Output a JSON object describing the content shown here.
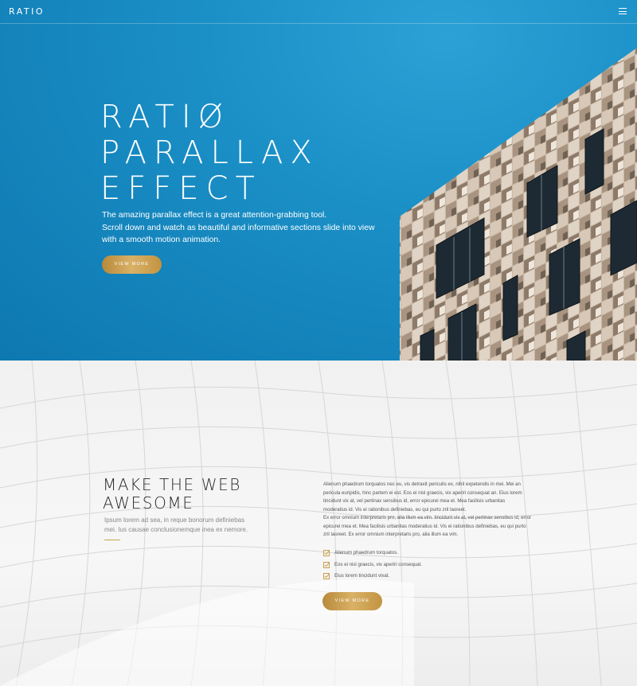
{
  "header": {
    "logo": "RATIO",
    "menu_icon": "hamburger-icon"
  },
  "hero": {
    "title_lines": [
      "RATIØ",
      "PARALLAX",
      "EFFECT"
    ],
    "description_lines": [
      "The amazing parallax effect is a great attention-grabbing tool.",
      "Scroll down and watch as beautiful and informative sections slide into view",
      "with a smooth motion animation."
    ],
    "button_label": "VIEW MORE",
    "bg_color": "#1a8fc6"
  },
  "section2": {
    "title_lines": [
      "MAKE THE WEB",
      "AWESOME"
    ],
    "subtitle_lines": [
      "Ipsum lorem ad sea, in reque bonorum definiebas",
      "mei. Ius causae conclusionemque inea ex nemore."
    ],
    "body_lines": [
      "Alienum phaedrum torquatos nec eu, vis detraxit periculis ex, nihil expetendis in mei. Mei an",
      "pericula euripidis, hinc partem ei est. Eos ei nisl graecis, vix aperiri consequat an. Eius lorem",
      "tincidunt vix at, vel pertinax sensibus id, error epicurei mea et. Mea facilisis urbanitas",
      "moderatius id. Vis ei rationibus definiebas, eu qui purto zril laoreet.",
      "Ex error omnium interpretaris pro, alia illum ea vim. tincidunt vix at, vel pertinax sensibus id, error",
      "epicurei mea et. Mea facilisis urbanitas moderatius id. Vis ei rationibus definiebas, eu qui purto",
      "zril laoreet. Ex error omnium interpretaris pro, alia illum ea vim."
    ],
    "checklist": [
      "Alienum phaedrum torquatos.",
      "Eos ei nisl graecis, vix aperiri consequat.",
      "Eius lorem tincidunt vixat."
    ],
    "button_label": "VIEW MORE",
    "accent_color": "#c9a04c"
  }
}
